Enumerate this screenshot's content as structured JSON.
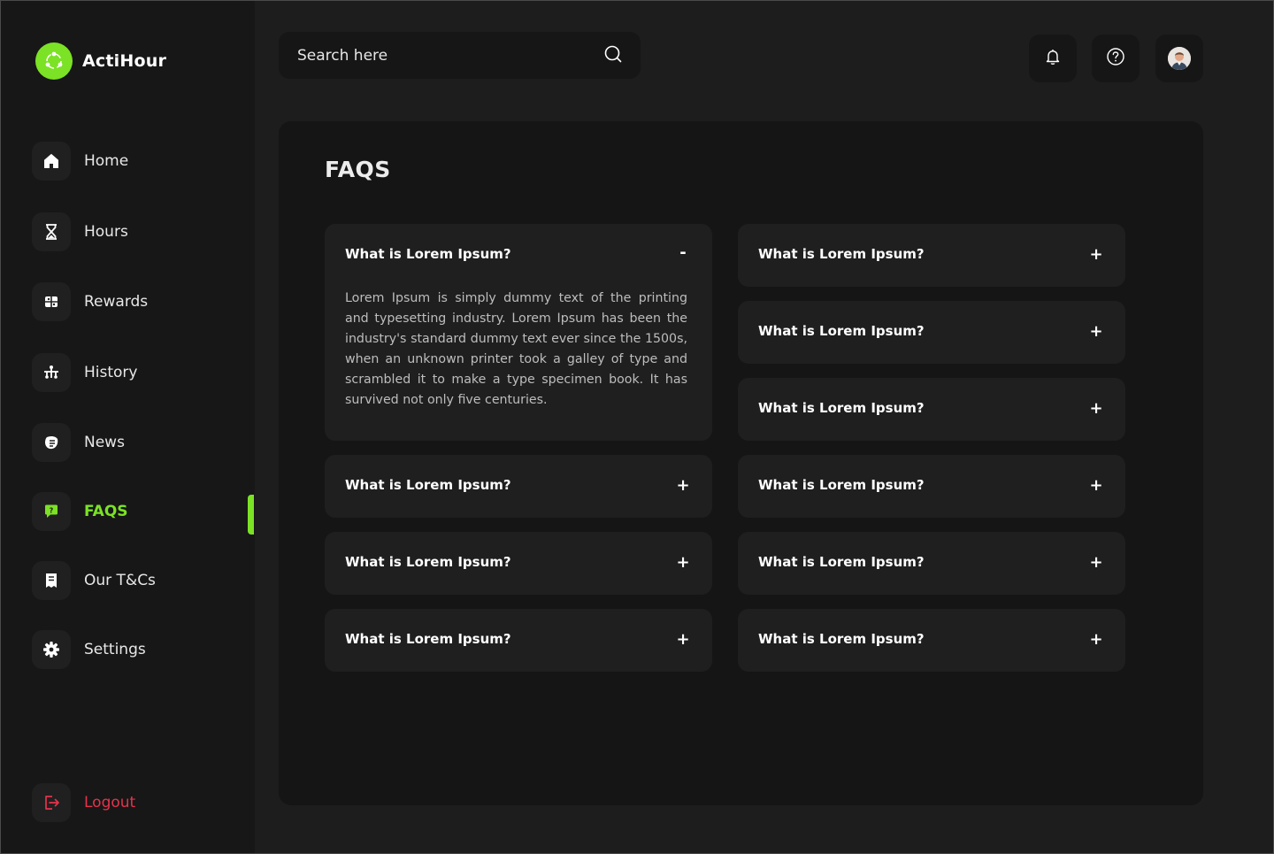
{
  "brand": {
    "name": "ActiHour",
    "accent_color": "#7be225"
  },
  "sidebar": {
    "items": [
      {
        "label": "Home",
        "icon": "home-icon"
      },
      {
        "label": "Hours",
        "icon": "hourglass-icon"
      },
      {
        "label": "Rewards",
        "icon": "rewards-icon"
      },
      {
        "label": "History",
        "icon": "history-icon"
      },
      {
        "label": "News",
        "icon": "news-icon"
      },
      {
        "label": "FAQS",
        "icon": "faq-icon",
        "active": true
      },
      {
        "label": "Our T&Cs",
        "icon": "document-icon"
      },
      {
        "label": "Settings",
        "icon": "gear-icon"
      }
    ],
    "logout": {
      "label": "Logout",
      "icon": "logout-icon",
      "color": "#e5334b"
    }
  },
  "search": {
    "placeholder": "Search here",
    "icon": "search-icon"
  },
  "header": {
    "buttons": [
      {
        "icon": "bell-icon"
      },
      {
        "icon": "help-icon"
      },
      {
        "icon": "avatar"
      }
    ]
  },
  "main": {
    "title": "FAQS",
    "faqs_left": [
      {
        "question": "What is Lorem Ipsum?",
        "toggle": "-",
        "expanded": true,
        "answer": "Lorem Ipsum is simply dummy text of the printing and typesetting industry. Lorem Ipsum has been the industry's standard dummy text ever since the 1500s, when an unknown printer took a galley of type and scrambled it to make a type specimen book. It has survived not only five centuries."
      },
      {
        "question": "What is Lorem Ipsum?",
        "toggle": "+"
      },
      {
        "question": "What is Lorem Ipsum?",
        "toggle": "+"
      },
      {
        "question": "What is Lorem Ipsum?",
        "toggle": "+"
      }
    ],
    "faqs_right": [
      {
        "question": "What is Lorem Ipsum?",
        "toggle": "+"
      },
      {
        "question": "What is Lorem Ipsum?",
        "toggle": "+"
      },
      {
        "question": "What is Lorem Ipsum?",
        "toggle": "+"
      },
      {
        "question": "What is Lorem Ipsum?",
        "toggle": "+"
      },
      {
        "question": "What is Lorem Ipsum?",
        "toggle": "+"
      },
      {
        "question": "What is Lorem Ipsum?",
        "toggle": "+"
      }
    ]
  }
}
